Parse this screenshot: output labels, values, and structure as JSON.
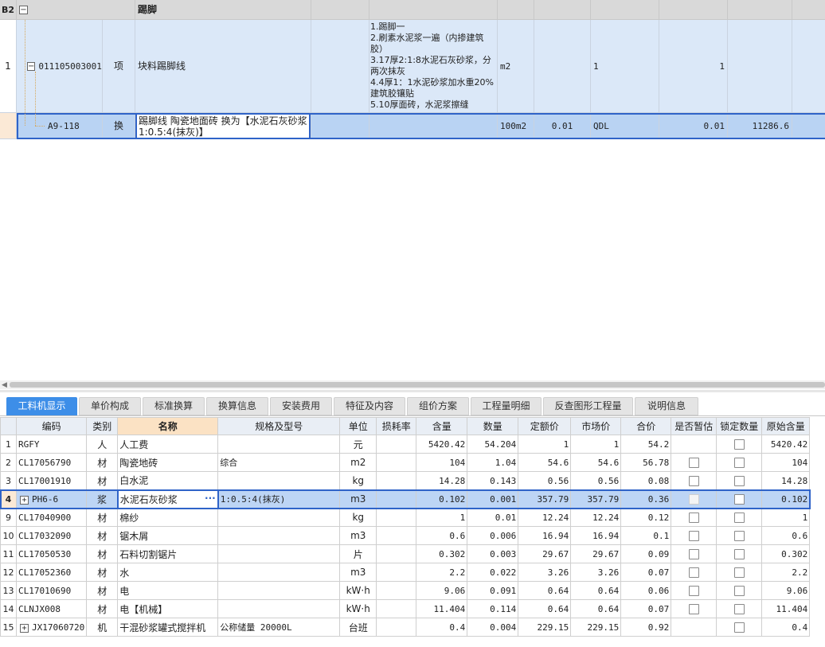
{
  "top_grid": {
    "section_row": {
      "row_label": "B2",
      "toggle": "−",
      "name": "踢脚"
    },
    "item_row": {
      "row_num": "1",
      "toggle": "−",
      "code": "011105003001",
      "type": "项",
      "name": "块料踢脚线",
      "features": [
        "1.踢脚一",
        "2.刷素水泥浆一遍（内掺建筑胶）",
        "3.17厚2:1:8水泥石灰砂浆，分两次抹灰",
        "4.4厚1：1水泥砂浆加水重20%建筑胶镶贴",
        "5.10厚面砖，水泥浆擦缝"
      ],
      "unit": "m2",
      "expr": "1",
      "quantity": "1"
    },
    "quota_row": {
      "row_num": "",
      "code": "A9-118",
      "type": "换",
      "name": "踢脚线 陶瓷地面砖  换为【水泥石灰砂浆1:0.5:4(抹灰)】",
      "unit": "100m2",
      "content": "0.01",
      "expr": "QDL",
      "quantity": "0.01",
      "price": "11286.6"
    }
  },
  "tabs": [
    {
      "label": "工料机显示",
      "active": true
    },
    {
      "label": "单价构成"
    },
    {
      "label": "标准换算"
    },
    {
      "label": "换算信息"
    },
    {
      "label": "安装费用"
    },
    {
      "label": "特征及内容"
    },
    {
      "label": "组价方案"
    },
    {
      "label": "工程量明细"
    },
    {
      "label": "反查图形工程量"
    },
    {
      "label": "说明信息"
    }
  ],
  "resource_table": {
    "columns": [
      "编码",
      "类别",
      "名称",
      "规格及型号",
      "单位",
      "损耗率",
      "含量",
      "数量",
      "定额价",
      "市场价",
      "合价",
      "是否暂估",
      "锁定数量",
      "原始含量"
    ],
    "rows": [
      {
        "n": "1",
        "code": "RGFY",
        "cat": "人",
        "name": "人工费",
        "spec": "",
        "unit": "元",
        "loss": "",
        "content": "5420.42",
        "qty": "54.204",
        "quota": "1",
        "market": "1",
        "total": "54.2",
        "est": false,
        "lock": true,
        "orig": "5420.42"
      },
      {
        "n": "2",
        "code": "CL17056790",
        "cat": "材",
        "name": "陶瓷地砖",
        "spec": "综合",
        "unit": "m2",
        "loss": "",
        "content": "104",
        "qty": "1.04",
        "quota": "54.6",
        "market": "54.6",
        "total": "56.78",
        "est": true,
        "lock": true,
        "orig": "104"
      },
      {
        "n": "3",
        "code": "CL17001910",
        "cat": "材",
        "name": "白水泥",
        "spec": "",
        "unit": "kg",
        "loss": "",
        "content": "14.28",
        "qty": "0.143",
        "quota": "0.56",
        "market": "0.56",
        "total": "0.08",
        "est": true,
        "lock": true,
        "orig": "14.28"
      },
      {
        "n": "4",
        "code": "PH6-6",
        "cat": "浆",
        "name": "水泥石灰砂浆",
        "spec": "1:0.5:4(抹灰)",
        "unit": "m3",
        "loss": "",
        "content": "0.102",
        "qty": "0.001",
        "quota": "357.79",
        "market": "357.79",
        "total": "0.36",
        "est": true,
        "lock": true,
        "orig": "0.102",
        "expand": "+",
        "selected": true,
        "more": "···"
      },
      {
        "n": "9",
        "code": "CL17040900",
        "cat": "材",
        "name": "棉纱",
        "spec": "",
        "unit": "kg",
        "loss": "",
        "content": "1",
        "qty": "0.01",
        "quota": "12.24",
        "market": "12.24",
        "total": "0.12",
        "est": true,
        "lock": true,
        "orig": "1"
      },
      {
        "n": "10",
        "code": "CL17032090",
        "cat": "材",
        "name": "锯木屑",
        "spec": "",
        "unit": "m3",
        "loss": "",
        "content": "0.6",
        "qty": "0.006",
        "quota": "16.94",
        "market": "16.94",
        "total": "0.1",
        "est": true,
        "lock": true,
        "orig": "0.6"
      },
      {
        "n": "11",
        "code": "CL17050530",
        "cat": "材",
        "name": "石料切割锯片",
        "spec": "",
        "unit": "片",
        "loss": "",
        "content": "0.302",
        "qty": "0.003",
        "quota": "29.67",
        "market": "29.67",
        "total": "0.09",
        "est": true,
        "lock": true,
        "orig": "0.302"
      },
      {
        "n": "12",
        "code": "CL17052360",
        "cat": "材",
        "name": "水",
        "spec": "",
        "unit": "m3",
        "loss": "",
        "content": "2.2",
        "qty": "0.022",
        "quota": "3.26",
        "market": "3.26",
        "total": "0.07",
        "est": true,
        "lock": true,
        "orig": "2.2"
      },
      {
        "n": "13",
        "code": "CL17010690",
        "cat": "材",
        "name": "电",
        "spec": "",
        "unit": "kW·h",
        "loss": "",
        "content": "9.06",
        "qty": "0.091",
        "quota": "0.64",
        "market": "0.64",
        "total": "0.06",
        "est": true,
        "lock": true,
        "orig": "9.06"
      },
      {
        "n": "14",
        "code": "CLNJX008",
        "cat": "材",
        "name": "电【机械】",
        "spec": "",
        "unit": "kW·h",
        "loss": "",
        "content": "11.404",
        "qty": "0.114",
        "quota": "0.64",
        "market": "0.64",
        "total": "0.07",
        "est": true,
        "lock": true,
        "orig": "11.404"
      },
      {
        "n": "15",
        "code": "JX17060720",
        "cat": "机",
        "name": "干混砂浆罐式搅拌机",
        "spec": "公称储量 20000L",
        "unit": "台班",
        "loss": "",
        "content": "0.4",
        "qty": "0.004",
        "quota": "229.15",
        "market": "229.15",
        "total": "0.92",
        "est": false,
        "lock": true,
        "orig": "0.4",
        "expand": "+"
      }
    ]
  }
}
